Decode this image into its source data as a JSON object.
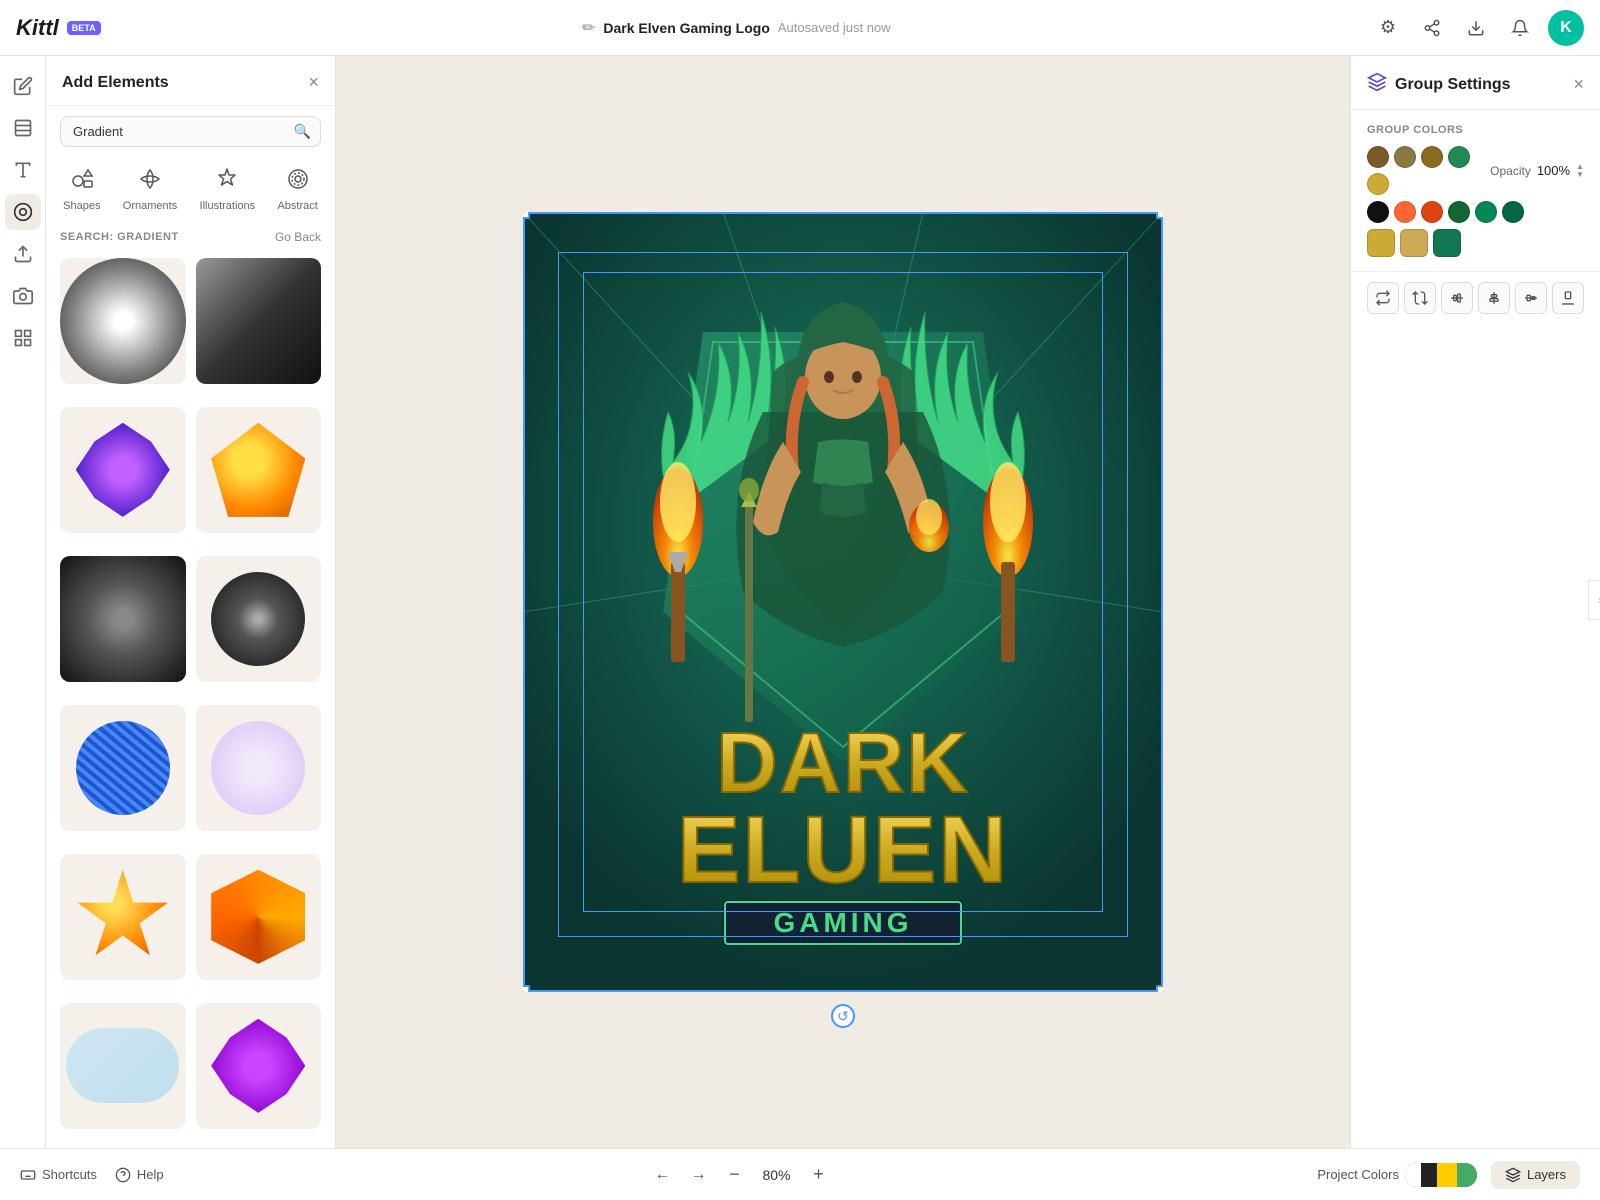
{
  "app": {
    "name": "Kittl",
    "beta_label": "BETA"
  },
  "header": {
    "pen_icon": "✏",
    "project_title": "Dark Elven Gaming Logo",
    "autosaved": "Autosaved just now",
    "settings_icon": "⚙",
    "share_icon": "↑",
    "download_icon": "↓",
    "bell_icon": "🔔",
    "avatar_initial": "K"
  },
  "left_nav": {
    "items": [
      {
        "id": "edit",
        "icon": "✏",
        "label": "Edit"
      },
      {
        "id": "layers",
        "icon": "⊞",
        "label": "Layers"
      },
      {
        "id": "text",
        "icon": "T",
        "label": "Text"
      },
      {
        "id": "colors",
        "icon": "◉",
        "label": "Colors",
        "active": true
      },
      {
        "id": "upload",
        "icon": "↑",
        "label": "Upload"
      },
      {
        "id": "photo",
        "icon": "📷",
        "label": "Photo"
      },
      {
        "id": "grid",
        "icon": "⊞",
        "label": "Grid"
      }
    ]
  },
  "add_elements": {
    "title": "Add Elements",
    "search_placeholder": "Gradient",
    "search_value": "Gradient",
    "categories": [
      {
        "id": "shapes",
        "label": "Shapes",
        "icon": "shapes"
      },
      {
        "id": "ornaments",
        "label": "Ornaments",
        "icon": "ornaments"
      },
      {
        "id": "illustrations",
        "label": "Illustrations",
        "icon": "illustrations"
      },
      {
        "id": "abstract",
        "label": "Abstract",
        "icon": "abstract"
      }
    ],
    "search_label": "SEARCH: GRADIENT",
    "go_back": "Go Back",
    "elements": [
      "radial-bw-circle",
      "linear-dark-rect",
      "radial-purple-shape",
      "radial-orange-shape",
      "radial-dark-soft",
      "radial-dark-circle",
      "striped-blue-sphere",
      "soft-pink-sphere",
      "star-orange",
      "pinwheel",
      "cloud-shape",
      "purple-blob"
    ]
  },
  "canvas": {
    "zoom": "80%",
    "rotation_icon": "↺"
  },
  "bottom_bar": {
    "shortcuts_label": "Shortcuts",
    "help_label": "Help",
    "shortcuts_icon": "⌨",
    "help_icon": "?",
    "nav_left": "←",
    "nav_right": "→",
    "zoom_minus": "−",
    "zoom_plus": "+",
    "zoom_level": "80%",
    "project_colors": "Project Colors",
    "layers": "Layers"
  },
  "group_settings": {
    "title": "Group Settings",
    "icon": "◈",
    "close": "×",
    "colors_label": "GROUP COLORS",
    "opacity_label": "Opacity",
    "opacity_value": "100%",
    "swatches_row1": [
      "#7a5a2a",
      "#8a7a40",
      "#8a6a20",
      "#228855",
      "#ccaa33"
    ],
    "swatches_row2": [
      "#111111",
      "#ff6633",
      "#dd4411",
      "#116633",
      "#008855",
      "#006644"
    ],
    "swatches_row3": [
      "#ccaa33",
      "#ccaa55",
      "#117755"
    ],
    "transform_tools": [
      {
        "id": "flip-h",
        "icon": "⇔",
        "label": "Flip Horizontal"
      },
      {
        "id": "flip-v",
        "icon": "⇕",
        "label": "Flip Vertical"
      },
      {
        "id": "align-h",
        "icon": "⇹",
        "label": "Align Horizontal"
      },
      {
        "id": "align-top",
        "icon": "⬆",
        "label": "Align Top"
      },
      {
        "id": "align-center",
        "icon": "⬡",
        "label": "Align Center"
      },
      {
        "id": "align-bottom",
        "icon": "⬇",
        "label": "Align Bottom"
      }
    ]
  }
}
